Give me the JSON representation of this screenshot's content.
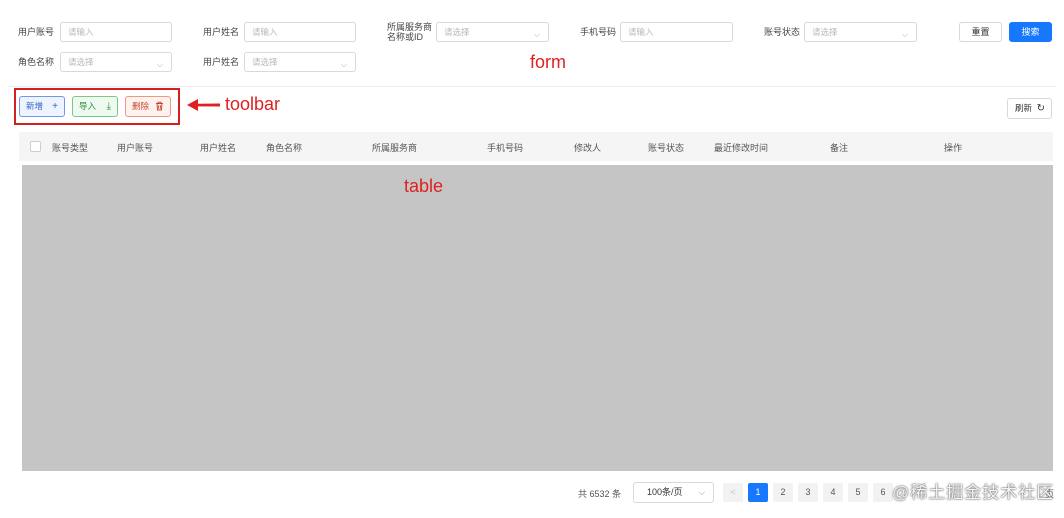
{
  "form": {
    "fields": [
      {
        "label": "用户账号",
        "placeholder": "请输入"
      },
      {
        "label": "用户姓名",
        "placeholder": "请输入"
      },
      {
        "label_line1": "所属服务商",
        "label_line2": "名称或ID",
        "placeholder": "请选择"
      },
      {
        "label": "手机号码",
        "placeholder": "请输入"
      },
      {
        "label": "账号状态",
        "placeholder": "请选择"
      },
      {
        "label": "角色名称",
        "placeholder": "请选择"
      },
      {
        "label": "用户姓名",
        "placeholder": "请选择"
      }
    ],
    "reset_label": "重置",
    "search_label": "搜索",
    "annotation": "form"
  },
  "toolbar": {
    "add_label": "新增",
    "import_label": "导入",
    "delete_label": "删除",
    "refresh_label": "刷新",
    "annotation": "toolbar",
    "annotation_color": "#e02020"
  },
  "table": {
    "columns": [
      "账号类型",
      "用户账号",
      "用户姓名",
      "角色名称",
      "所属服务商",
      "手机号码",
      "修改人",
      "账号状态",
      "最近修改时间",
      "备注",
      "操作"
    ],
    "annotation": "table"
  },
  "pagination": {
    "total_text": "共 6532 条",
    "page_size": "100条/页",
    "prev": "<",
    "pages": [
      "1",
      "2",
      "3",
      "4",
      "5",
      "6"
    ],
    "current_page": "1",
    "tail_text": "页"
  },
  "watermark": "@稀土掘金技术社区",
  "colors": {
    "primary": "#1677ff",
    "annotation": "#e02020",
    "table_body": "#c5c5c5"
  }
}
